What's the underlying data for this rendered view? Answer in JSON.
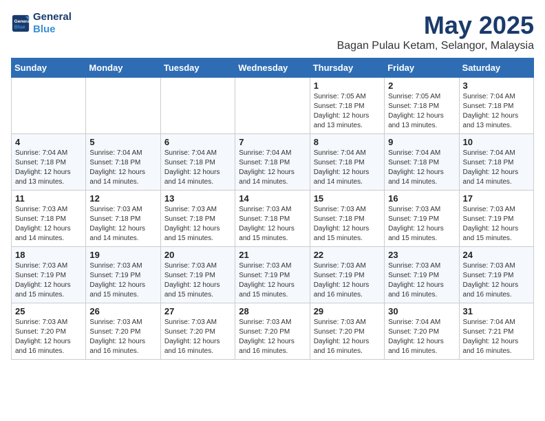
{
  "logo": {
    "line1": "General",
    "line2": "Blue"
  },
  "title": "May 2025",
  "subtitle": "Bagan Pulau Ketam, Selangor, Malaysia",
  "headers": [
    "Sunday",
    "Monday",
    "Tuesday",
    "Wednesday",
    "Thursday",
    "Friday",
    "Saturday"
  ],
  "weeks": [
    [
      {
        "day": "",
        "info": ""
      },
      {
        "day": "",
        "info": ""
      },
      {
        "day": "",
        "info": ""
      },
      {
        "day": "",
        "info": ""
      },
      {
        "day": "1",
        "info": "Sunrise: 7:05 AM\nSunset: 7:18 PM\nDaylight: 12 hours\nand 13 minutes."
      },
      {
        "day": "2",
        "info": "Sunrise: 7:05 AM\nSunset: 7:18 PM\nDaylight: 12 hours\nand 13 minutes."
      },
      {
        "day": "3",
        "info": "Sunrise: 7:04 AM\nSunset: 7:18 PM\nDaylight: 12 hours\nand 13 minutes."
      }
    ],
    [
      {
        "day": "4",
        "info": "Sunrise: 7:04 AM\nSunset: 7:18 PM\nDaylight: 12 hours\nand 13 minutes."
      },
      {
        "day": "5",
        "info": "Sunrise: 7:04 AM\nSunset: 7:18 PM\nDaylight: 12 hours\nand 14 minutes."
      },
      {
        "day": "6",
        "info": "Sunrise: 7:04 AM\nSunset: 7:18 PM\nDaylight: 12 hours\nand 14 minutes."
      },
      {
        "day": "7",
        "info": "Sunrise: 7:04 AM\nSunset: 7:18 PM\nDaylight: 12 hours\nand 14 minutes."
      },
      {
        "day": "8",
        "info": "Sunrise: 7:04 AM\nSunset: 7:18 PM\nDaylight: 12 hours\nand 14 minutes."
      },
      {
        "day": "9",
        "info": "Sunrise: 7:04 AM\nSunset: 7:18 PM\nDaylight: 12 hours\nand 14 minutes."
      },
      {
        "day": "10",
        "info": "Sunrise: 7:04 AM\nSunset: 7:18 PM\nDaylight: 12 hours\nand 14 minutes."
      }
    ],
    [
      {
        "day": "11",
        "info": "Sunrise: 7:03 AM\nSunset: 7:18 PM\nDaylight: 12 hours\nand 14 minutes."
      },
      {
        "day": "12",
        "info": "Sunrise: 7:03 AM\nSunset: 7:18 PM\nDaylight: 12 hours\nand 14 minutes."
      },
      {
        "day": "13",
        "info": "Sunrise: 7:03 AM\nSunset: 7:18 PM\nDaylight: 12 hours\nand 15 minutes."
      },
      {
        "day": "14",
        "info": "Sunrise: 7:03 AM\nSunset: 7:18 PM\nDaylight: 12 hours\nand 15 minutes."
      },
      {
        "day": "15",
        "info": "Sunrise: 7:03 AM\nSunset: 7:18 PM\nDaylight: 12 hours\nand 15 minutes."
      },
      {
        "day": "16",
        "info": "Sunrise: 7:03 AM\nSunset: 7:19 PM\nDaylight: 12 hours\nand 15 minutes."
      },
      {
        "day": "17",
        "info": "Sunrise: 7:03 AM\nSunset: 7:19 PM\nDaylight: 12 hours\nand 15 minutes."
      }
    ],
    [
      {
        "day": "18",
        "info": "Sunrise: 7:03 AM\nSunset: 7:19 PM\nDaylight: 12 hours\nand 15 minutes."
      },
      {
        "day": "19",
        "info": "Sunrise: 7:03 AM\nSunset: 7:19 PM\nDaylight: 12 hours\nand 15 minutes."
      },
      {
        "day": "20",
        "info": "Sunrise: 7:03 AM\nSunset: 7:19 PM\nDaylight: 12 hours\nand 15 minutes."
      },
      {
        "day": "21",
        "info": "Sunrise: 7:03 AM\nSunset: 7:19 PM\nDaylight: 12 hours\nand 15 minutes."
      },
      {
        "day": "22",
        "info": "Sunrise: 7:03 AM\nSunset: 7:19 PM\nDaylight: 12 hours\nand 16 minutes."
      },
      {
        "day": "23",
        "info": "Sunrise: 7:03 AM\nSunset: 7:19 PM\nDaylight: 12 hours\nand 16 minutes."
      },
      {
        "day": "24",
        "info": "Sunrise: 7:03 AM\nSunset: 7:19 PM\nDaylight: 12 hours\nand 16 minutes."
      }
    ],
    [
      {
        "day": "25",
        "info": "Sunrise: 7:03 AM\nSunset: 7:20 PM\nDaylight: 12 hours\nand 16 minutes."
      },
      {
        "day": "26",
        "info": "Sunrise: 7:03 AM\nSunset: 7:20 PM\nDaylight: 12 hours\nand 16 minutes."
      },
      {
        "day": "27",
        "info": "Sunrise: 7:03 AM\nSunset: 7:20 PM\nDaylight: 12 hours\nand 16 minutes."
      },
      {
        "day": "28",
        "info": "Sunrise: 7:03 AM\nSunset: 7:20 PM\nDaylight: 12 hours\nand 16 minutes."
      },
      {
        "day": "29",
        "info": "Sunrise: 7:03 AM\nSunset: 7:20 PM\nDaylight: 12 hours\nand 16 minutes."
      },
      {
        "day": "30",
        "info": "Sunrise: 7:04 AM\nSunset: 7:20 PM\nDaylight: 12 hours\nand 16 minutes."
      },
      {
        "day": "31",
        "info": "Sunrise: 7:04 AM\nSunset: 7:21 PM\nDaylight: 12 hours\nand 16 minutes."
      }
    ]
  ]
}
